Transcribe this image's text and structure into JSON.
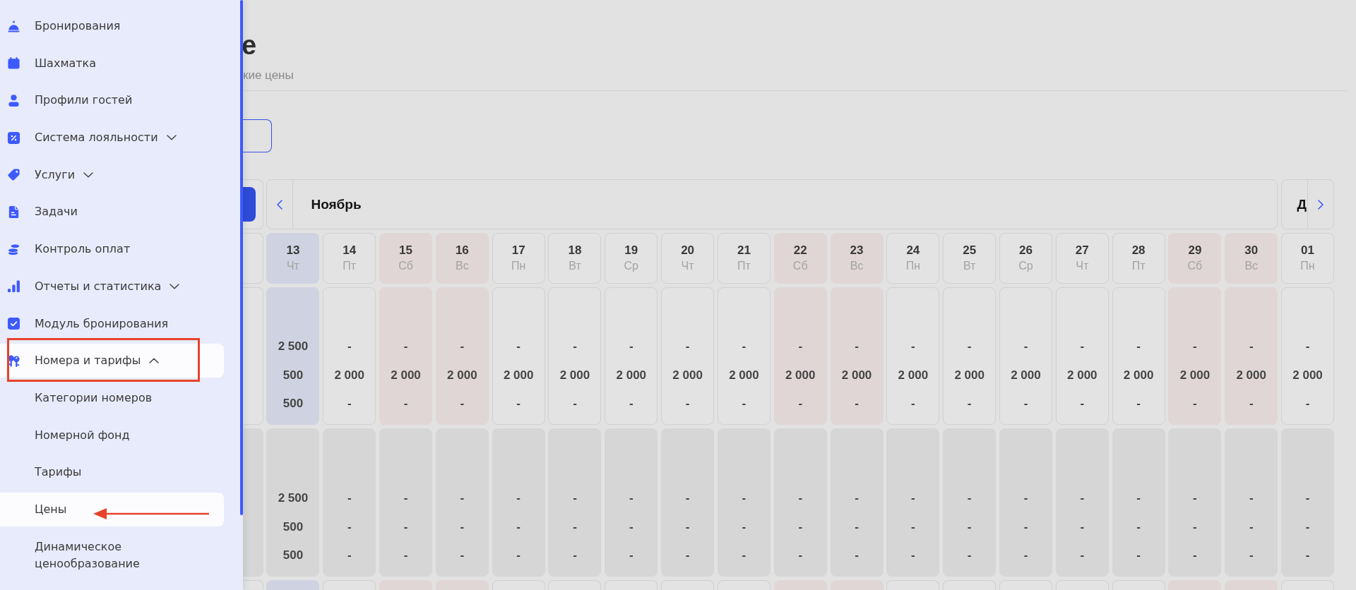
{
  "sidebar": {
    "items": [
      {
        "label": "Бронирования",
        "selected": false
      },
      {
        "label": "Шахматка",
        "selected": false
      },
      {
        "label": "Профили гостей",
        "selected": false
      },
      {
        "label": "Система лояльности",
        "selected": false,
        "expanded": false
      },
      {
        "label": "Услуги",
        "selected": false,
        "expanded": false
      },
      {
        "label": "Задачи",
        "selected": false
      },
      {
        "label": "Контроль оплат",
        "selected": false
      },
      {
        "label": "Отчеты и статистика",
        "selected": false,
        "expanded": false
      },
      {
        "label": "Модуль бронирования",
        "selected": false
      },
      {
        "label": "Номера и тарифы",
        "selected": true,
        "expanded": true,
        "annotation": {
          "kind": "frame"
        },
        "children": [
          {
            "label": "Категории номеров",
            "selected": false
          },
          {
            "label": "Номерной фонд",
            "selected": false
          },
          {
            "label": "Тарифы",
            "selected": false
          },
          {
            "label": "Цены",
            "selected": true,
            "annotation": {
              "kind": "arrow"
            }
          },
          {
            "label": "Динамическое ценообразование",
            "selected": false
          }
        ]
      }
    ]
  },
  "page": {
    "title": "е",
    "subtitle": "кие цены"
  },
  "calendar": {
    "months": [
      {
        "name": "Ноябрь",
        "days": [
          {
            "day": "13",
            "weekday": "Чт",
            "kind": "today"
          },
          {
            "day": "14",
            "weekday": "Пт",
            "kind": "weekday"
          },
          {
            "day": "15",
            "weekday": "Сб",
            "kind": "weekend"
          },
          {
            "day": "16",
            "weekday": "Вс",
            "kind": "weekend"
          },
          {
            "day": "17",
            "weekday": "Пн",
            "kind": "weekday"
          },
          {
            "day": "18",
            "weekday": "Вт",
            "kind": "weekday"
          },
          {
            "day": "19",
            "weekday": "Ср",
            "kind": "weekday"
          },
          {
            "day": "20",
            "weekday": "Чт",
            "kind": "weekday"
          },
          {
            "day": "21",
            "weekday": "Пт",
            "kind": "weekday"
          },
          {
            "day": "22",
            "weekday": "Сб",
            "kind": "weekend"
          },
          {
            "day": "23",
            "weekday": "Вс",
            "kind": "weekend"
          },
          {
            "day": "24",
            "weekday": "Пн",
            "kind": "weekday"
          },
          {
            "day": "25",
            "weekday": "Вт",
            "kind": "weekday"
          },
          {
            "day": "26",
            "weekday": "Ср",
            "kind": "weekday"
          },
          {
            "day": "27",
            "weekday": "Чт",
            "kind": "weekday"
          },
          {
            "day": "28",
            "weekday": "Пт",
            "kind": "weekday"
          },
          {
            "day": "29",
            "weekday": "Сб",
            "kind": "weekend"
          },
          {
            "day": "30",
            "weekday": "Вс",
            "kind": "weekend"
          }
        ]
      },
      {
        "name": "Д",
        "days": [
          {
            "day": "01",
            "weekday": "Пн",
            "kind": "weekday"
          }
        ]
      }
    ],
    "rows": [
      {
        "kind": "active",
        "cells": [
          [
            "2 500",
            "500",
            "500"
          ],
          [
            "-",
            "2 000",
            "-"
          ],
          [
            "-",
            "2 000",
            "-"
          ],
          [
            "-",
            "2 000",
            "-"
          ],
          [
            "-",
            "2 000",
            "-"
          ],
          [
            "-",
            "2 000",
            "-"
          ],
          [
            "-",
            "2 000",
            "-"
          ],
          [
            "-",
            "2 000",
            "-"
          ],
          [
            "-",
            "2 000",
            "-"
          ],
          [
            "-",
            "2 000",
            "-"
          ],
          [
            "-",
            "2 000",
            "-"
          ],
          [
            "-",
            "2 000",
            "-"
          ],
          [
            "-",
            "2 000",
            "-"
          ],
          [
            "-",
            "2 000",
            "-"
          ],
          [
            "-",
            "2 000",
            "-"
          ],
          [
            "-",
            "2 000",
            "-"
          ],
          [
            "-",
            "2 000",
            "-"
          ],
          [
            "-",
            "2 000",
            "-"
          ],
          [
            "-",
            "2 000",
            "-"
          ]
        ]
      },
      {
        "kind": "inactive",
        "cells": [
          [
            "2 500",
            "500",
            "500"
          ],
          [
            "-",
            "-",
            "-"
          ],
          [
            "-",
            "-",
            "-"
          ],
          [
            "-",
            "-",
            "-"
          ],
          [
            "-",
            "-",
            "-"
          ],
          [
            "-",
            "-",
            "-"
          ],
          [
            "-",
            "-",
            "-"
          ],
          [
            "-",
            "-",
            "-"
          ],
          [
            "-",
            "-",
            "-"
          ],
          [
            "-",
            "-",
            "-"
          ],
          [
            "-",
            "-",
            "-"
          ],
          [
            "-",
            "-",
            "-"
          ],
          [
            "-",
            "-",
            "-"
          ],
          [
            "-",
            "-",
            "-"
          ],
          [
            "-",
            "-",
            "-"
          ],
          [
            "-",
            "-",
            "-"
          ],
          [
            "-",
            "-",
            "-"
          ],
          [
            "-",
            "-",
            "-"
          ],
          [
            "-",
            "-",
            "-"
          ]
        ]
      },
      {
        "kind": "active"
      }
    ]
  }
}
